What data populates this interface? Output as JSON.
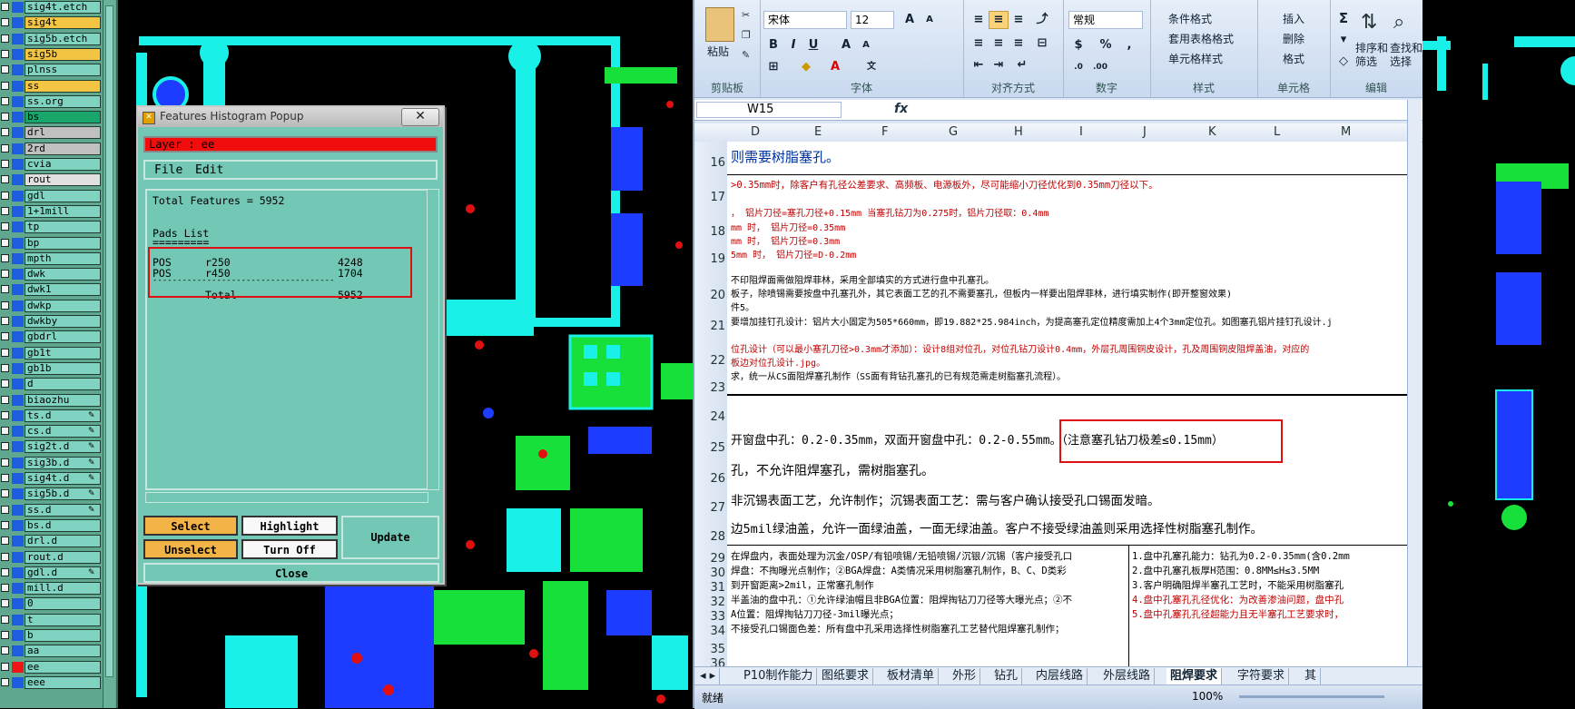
{
  "layers": [
    {
      "name": "sig4t.etch",
      "color": "#1e5de0",
      "pencil": false
    },
    {
      "name": "sig4t",
      "color": "#1e5de0",
      "pencil": false,
      "highlight": "#f4c542"
    },
    {
      "name": "sig5b.etch",
      "color": "#1e5de0",
      "pencil": false
    },
    {
      "name": "sig5b",
      "color": "#1e5de0",
      "pencil": false,
      "highlight": "#f4c542"
    },
    {
      "name": "plnss",
      "color": "#1e5de0",
      "pencil": false
    },
    {
      "name": "ss",
      "color": "#1e5de0",
      "pencil": false,
      "highlight": "#f4c542"
    },
    {
      "name": "ss.org",
      "color": "#1e5de0",
      "pencil": false
    },
    {
      "name": "bs",
      "color": "#1e5de0",
      "pencil": false,
      "highlight": "#18a66a"
    },
    {
      "name": "drl",
      "color": "#1e5de0",
      "pencil": false,
      "highlight": "#c0c0c0"
    },
    {
      "name": "2rd",
      "color": "#1e5de0",
      "pencil": false,
      "highlight": "#c0c0c0"
    },
    {
      "name": "cvia",
      "color": "#1e5de0",
      "pencil": false
    },
    {
      "name": "rout",
      "color": "#1e5de0",
      "pencil": false,
      "highlight": "#e0e0e0"
    },
    {
      "name": "gdl",
      "color": "#1e5de0",
      "pencil": false
    },
    {
      "name": "1+1mill",
      "color": "#1e5de0",
      "pencil": false
    },
    {
      "name": "tp",
      "color": "#1e5de0",
      "pencil": false
    },
    {
      "name": "bp",
      "color": "#1e5de0",
      "pencil": false
    },
    {
      "name": "mpth",
      "color": "#1e5de0",
      "pencil": false
    },
    {
      "name": "dwk",
      "color": "#1e5de0",
      "pencil": false
    },
    {
      "name": "dwk1",
      "color": "#1e5de0",
      "pencil": false
    },
    {
      "name": "dwkp",
      "color": "#1e5de0",
      "pencil": false
    },
    {
      "name": "dwkby",
      "color": "#1e5de0",
      "pencil": false
    },
    {
      "name": "gbdrl",
      "color": "#1e5de0",
      "pencil": false
    },
    {
      "name": "gb1t",
      "color": "#1e5de0",
      "pencil": false
    },
    {
      "name": "gb1b",
      "color": "#1e5de0",
      "pencil": false
    },
    {
      "name": "d",
      "color": "#1e5de0",
      "pencil": false
    },
    {
      "name": "biaozhu",
      "color": "#1e5de0",
      "pencil": false
    },
    {
      "name": "ts.d",
      "color": "#1e5de0",
      "pencil": true
    },
    {
      "name": "cs.d",
      "color": "#1e5de0",
      "pencil": true
    },
    {
      "name": "sig2t.d",
      "color": "#1e5de0",
      "pencil": true
    },
    {
      "name": "sig3b.d",
      "color": "#1e5de0",
      "pencil": true
    },
    {
      "name": "sig4t.d",
      "color": "#1e5de0",
      "pencil": true
    },
    {
      "name": "sig5b.d",
      "color": "#1e5de0",
      "pencil": true
    },
    {
      "name": "ss.d",
      "color": "#1e5de0",
      "pencil": true
    },
    {
      "name": "bs.d",
      "color": "#1e5de0",
      "pencil": false
    },
    {
      "name": "drl.d",
      "color": "#1e5de0",
      "pencil": false
    },
    {
      "name": "rout.d",
      "color": "#1e5de0",
      "pencil": false
    },
    {
      "name": "gdl.d",
      "color": "#1e5de0",
      "pencil": true
    },
    {
      "name": "mill.d",
      "color": "#1e5de0",
      "pencil": false
    },
    {
      "name": "0",
      "color": "#1e5de0",
      "pencil": false
    },
    {
      "name": "t",
      "color": "#1e5de0",
      "pencil": false
    },
    {
      "name": "b",
      "color": "#1e5de0",
      "pencil": false
    },
    {
      "name": "aa",
      "color": "#1e5de0",
      "pencil": false
    },
    {
      "name": "ee",
      "color": "#f01414",
      "pencil": false
    },
    {
      "name": "eee",
      "color": "#1e5de0",
      "pencil": false
    }
  ],
  "popup": {
    "title": "Features Histogram Popup",
    "layer_label": "Layer :  ee",
    "menu": {
      "file": "File",
      "edit": "Edit"
    },
    "total_features": "Total Features = 5952",
    "list_title": "Pads List",
    "list_underline": "=========",
    "rows": [
      {
        "pol": "POS",
        "sym": "r250",
        "count": "4248"
      },
      {
        "pol": "POS",
        "sym": "r450",
        "count": "1704"
      }
    ],
    "separator": "-------------------------------------",
    "total_label": "Total",
    "total_value": "5952",
    "buttons": {
      "select": "Select",
      "highlight": "Highlight",
      "unselect": "Unselect",
      "turn_off": "Turn Off",
      "update": "Update",
      "close": "Close"
    }
  },
  "excel": {
    "ribbon": {
      "paste": "粘贴",
      "clipboard": "剪贴板",
      "font_name": "宋体",
      "font_size": "12",
      "font_group": "字体",
      "align_group": "对齐方式",
      "number_format": "常规",
      "number_group": "数字",
      "cond_format": "条件格式",
      "table_format": "套用表格格式",
      "cell_style": "单元格样式",
      "style_group": "样式",
      "insert": "插入",
      "delete": "删除",
      "format": "格式",
      "cells_group": "单元格",
      "sort_filter": "排序和\n筛选",
      "find_select": "查找和\n选择",
      "edit_group": "编辑"
    },
    "name_box": "W15",
    "fx": "fx",
    "columns": [
      "D",
      "E",
      "F",
      "G",
      "H",
      "I",
      "J",
      "K",
      "L",
      "M"
    ],
    "rows": [
      "16",
      "17",
      "18",
      "19",
      "20",
      "21",
      "22",
      "23",
      "24",
      "25",
      "26",
      "27",
      "28",
      "29",
      "30",
      "31",
      "32",
      "33",
      "34",
      "35",
      "36"
    ],
    "cells": {
      "r16": "则需要树脂塞孔。",
      "r17": ">0.35mm时，除客户有孔径公差要求、高频板、电源板外，尽可能缩小刀径优化到0.35mm刀径以下。",
      "r18a": "，  铝片刀径=塞孔刀径+0.15mm    当塞孔钻刀为0.275时，铝片刀径取：0.4mm",
      "r18b": "mm 时，  铝片刀径=0.35mm",
      "r18c": "mm 时，  铝片刀径=0.3mm",
      "r19": "5mm 时，  铝片刀径=D-0.2mm",
      "r20a": "不印阻焊面需做阻焊菲林，采用全部填实的方式进行盘中孔塞孔。",
      "r20b": "板子，除喷锡需要按盘中孔塞孔外，其它表面工艺的孔不需要塞孔，但板内一样要出阻焊菲林，进行填实制作(即开整窗效果)",
      "r20c": "件5。",
      "r21": "要增加挂钉孔设计：铝片大小固定为505*660mm，即19.882*25.984inch，为提高塞孔定位精度需加上4个3mm定位孔。如图塞孔铝片挂钉孔设计.j",
      "r22a": "位孔设计（可以最小塞孔刀径>0.3mm才添加）：设计8组对位孔，对位孔钻刀设计0.4mm，外层孔周围铜皮设计，孔及周围铜皮阻焊盖油，对应的",
      "r22b": "板边对位孔设计.jpg。",
      "r23": "求，统一从CS面阻焊塞孔制作（SS面有背钻孔塞孔的已有规范需走树脂塞孔流程）。",
      "r25": "开窗盘中孔：0.2-0.35mm，双面开窗盘中孔：0.2-0.55mm。（注意塞孔钻刀极差≤0.15mm）",
      "r26": "孔，不允许阻焊塞孔，需树脂塞孔。",
      "r27": " 非沉锡表面工艺，允许制作；沉锡表面工艺：需与客户确认接受孔口锡面发暗。",
      "r28": "边5mil绿油盖，允许一面绿油盖，一面无绿油盖。客户不接受绿油盖则采用选择性树脂塞孔制作。",
      "r29": "在焊盘内，表面处理为沉金/OSP/有铅喷锡/无铅喷锡/沉银/沉锡（客户接受孔口",
      "r30": "焊盘：不掏曝光点制作；②BGA焊盘：A类情况采用树脂塞孔制作，B、C、D类彩",
      "r31": "到开窗距离>2mil，正常塞孔制作",
      "r32": "半盖油的盘中孔：①允许绿油帽且非BGA位置：阻焊掏钻刀刀径等大曝光点；②不",
      "r33": "A位置：阻焊掏钻刀刀径-3mil曝光点；",
      "r34": "不接受孔口锡面色差：所有盘中孔采用选择性树脂塞孔工艺替代阻焊塞孔制作；",
      "m29": "1.盘中孔塞孔能力：钻孔为0.2-0.35mm(含0.2mm",
      "m30": "2.盘中孔塞孔板厚H范围：0.8MM≤H≤3.5MM",
      "m31": "3.客户明确阻焊半塞孔工艺时，不能采用树脂塞孔",
      "m32": "4.盘中孔塞孔孔径优化：为改善渗油问题，盘中孔",
      "m33": "5.盘中孔塞孔孔径超能力且无半塞孔工艺要求时，"
    },
    "sheet_tabs": [
      "P10制作能力",
      "图纸要求",
      "板材清单",
      "外形",
      "钻孔",
      "内层线路",
      "外层线路",
      "阻焊要求",
      "字符要求",
      "其"
    ],
    "active_tab": "阻焊要求",
    "status": "就绪",
    "zoom": "100%"
  }
}
